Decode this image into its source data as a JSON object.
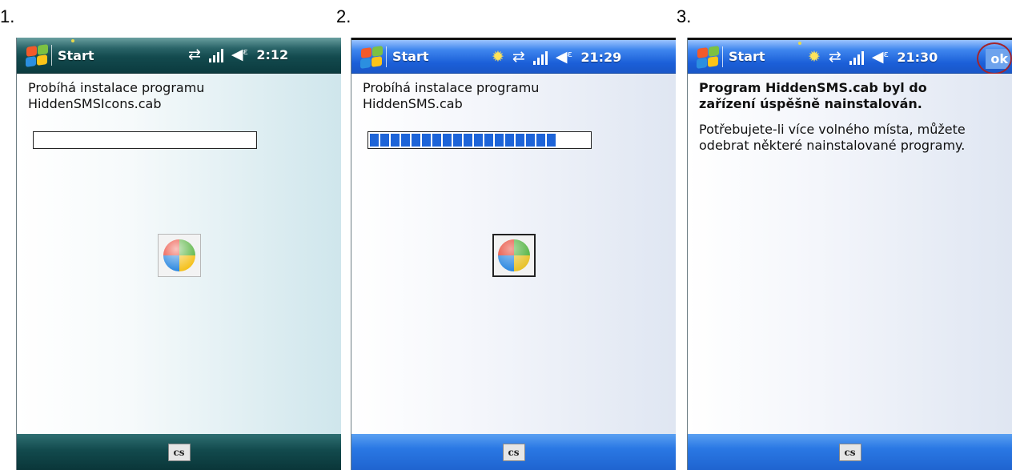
{
  "steps": [
    {
      "number": "1.",
      "titlebar": {
        "start_label": "Start",
        "clock": "2:12"
      },
      "install_text": "Probíhá instalace programu HiddenSMSIcons.cab",
      "progress": 0,
      "input_method": "cs"
    },
    {
      "number": "2.",
      "titlebar": {
        "start_label": "Start",
        "clock": "21:29"
      },
      "install_text": "Probíhá instalace programu HiddenSMS.cab",
      "progress": 0.86,
      "input_method": "cs"
    },
    {
      "number": "3.",
      "titlebar": {
        "start_label": "Start",
        "clock": "21:30",
        "ok_label": "ok"
      },
      "success_title": "Program HiddenSMS.cab byl do zařízení úspěšně nainstalován.",
      "success_body": "Potřebujete-li více volného místa, můžete odebrat některé nainstalované programy.",
      "input_method": "cs"
    }
  ],
  "icons": {
    "start": "windows-flag-icon",
    "connectivity": "sync-arrows-icon",
    "signal": "signal-strength-icon",
    "volume": "speaker-icon",
    "notification": "reminder-bell-icon",
    "keyboard": "input-panel-icon"
  },
  "colors": {
    "titlebar_teal": "#134a4e",
    "titlebar_blue": "#1b5fd8",
    "progress_blue": "#1d64d8",
    "ok_circle": "#a3242b"
  }
}
